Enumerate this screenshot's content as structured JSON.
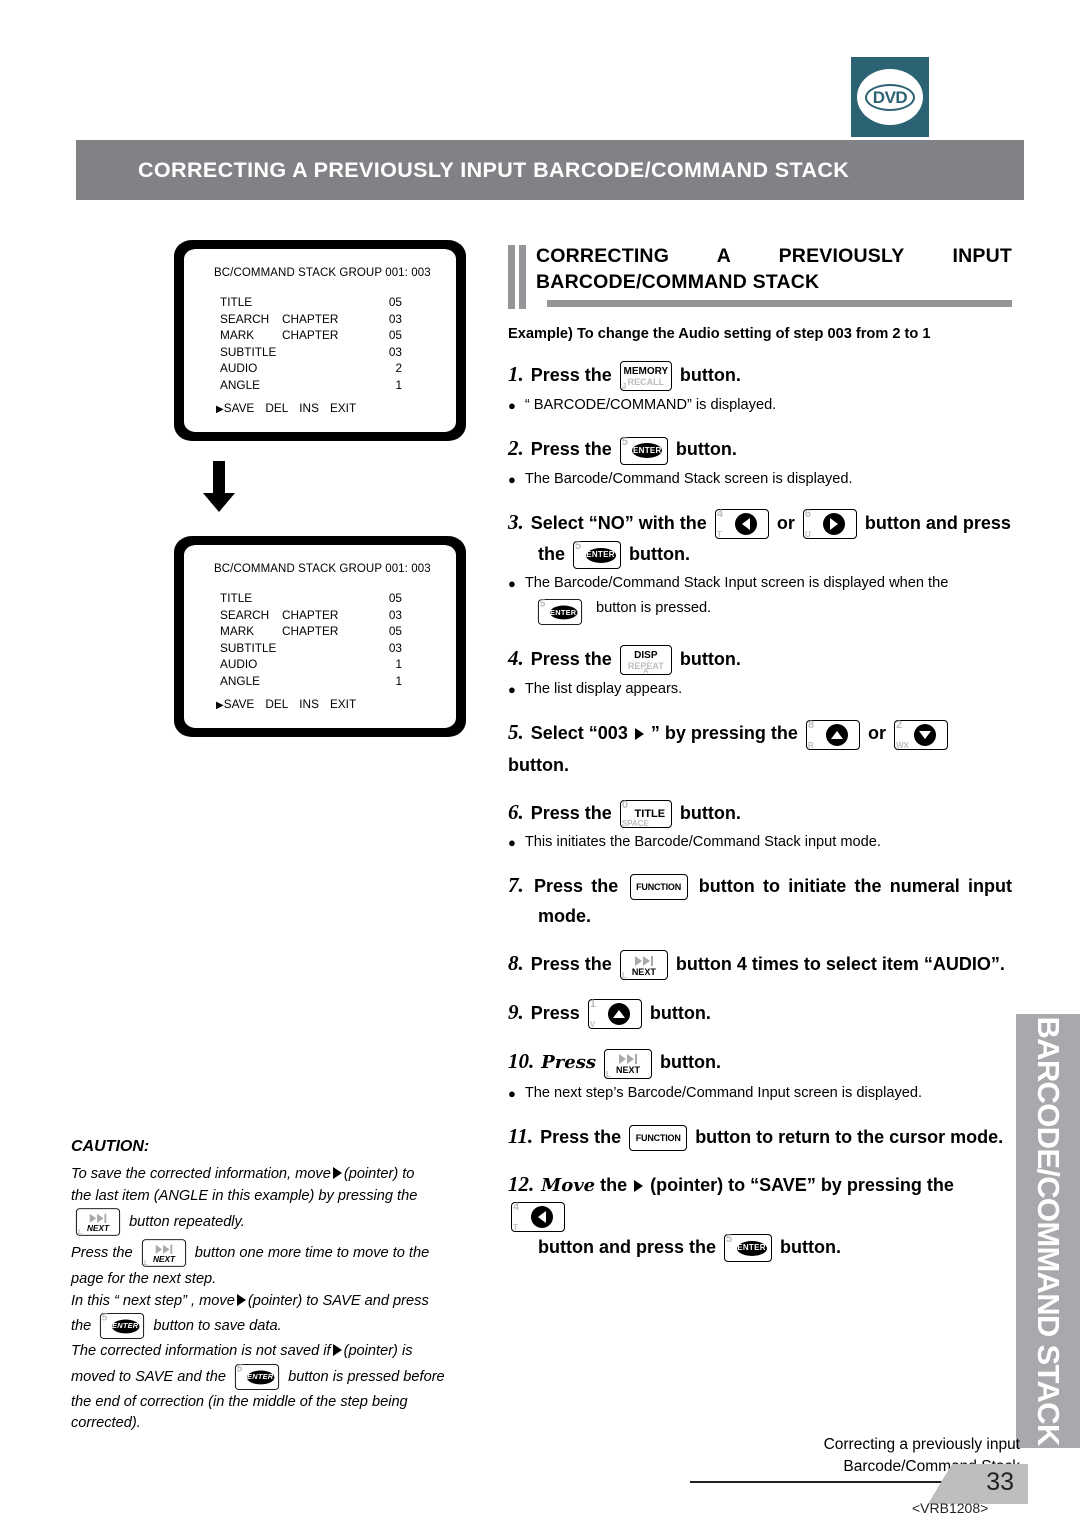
{
  "logo": {
    "text": "DVD"
  },
  "header": {
    "title": "CORRECTING A PREVIOUSLY INPUT BARCODE/COMMAND STACK"
  },
  "side_tab": {
    "text": "BARCODE/COMMAND STACK"
  },
  "section": {
    "title_line1": "CORRECTING A PREVIOUSLY INPUT",
    "title_line2": "BARCODE/COMMAND STACK",
    "example": "Example) To change the Audio setting of step 003 from 2 to 1"
  },
  "screens": [
    {
      "header": "BC/COMMAND STACK  GROUP  001: 003",
      "rows": [
        {
          "label": "TITLE",
          "label2": "",
          "value": "05"
        },
        {
          "label": "SEARCH",
          "label2": "CHAPTER",
          "value": "03"
        },
        {
          "label": "MARK",
          "label2": "CHAPTER",
          "value": "05"
        },
        {
          "label": "SUBTITLE",
          "label2": "",
          "value": "03"
        },
        {
          "label": "AUDIO",
          "label2": "",
          "value": "2"
        },
        {
          "label": "ANGLE",
          "label2": "",
          "value": "1"
        }
      ],
      "menu": [
        "SAVE",
        "DEL",
        "INS",
        "EXIT"
      ]
    },
    {
      "header": "BC/COMMAND STACK  GROUP  001: 003",
      "rows": [
        {
          "label": "TITLE",
          "label2": "",
          "value": "05"
        },
        {
          "label": "SEARCH",
          "label2": "CHAPTER",
          "value": "03"
        },
        {
          "label": "MARK",
          "label2": "CHAPTER",
          "value": "05"
        },
        {
          "label": "SUBTITLE",
          "label2": "",
          "value": "03"
        },
        {
          "label": "AUDIO",
          "label2": "",
          "value": "1"
        },
        {
          "label": "ANGLE",
          "label2": "",
          "value": "1"
        }
      ],
      "menu": [
        "SAVE",
        "DEL",
        "INS",
        "EXIT"
      ]
    }
  ],
  "buttons": {
    "memory_recall": {
      "top": "MEMORY",
      "mid": "RECALL",
      "corner": "J"
    },
    "enter": {
      "label": "ENTER",
      "corner": "5"
    },
    "left": {
      "corner_top": "4",
      "corner_bottom": "T"
    },
    "right": {
      "corner_top": "6",
      "corner_bottom": "U"
    },
    "up": {
      "corner_top": "8",
      "corner_bottom": "R"
    },
    "down": {
      "corner_top": "2",
      "corner_bottom": "WX"
    },
    "disp_repeat": {
      "top": "DISP",
      "mid": "REPEAT",
      "corner": "A"
    },
    "title": {
      "label": "TITLE",
      "corner_top": "0",
      "corner_bottom": "SPACE"
    },
    "function": {
      "label": "FUNCTION"
    },
    "next": {
      "label": "NEXT",
      "corner": "L"
    },
    "one": {
      "corner_top": "1",
      "corner_bottom": "V"
    }
  },
  "steps": [
    {
      "num": "1.",
      "text_before": "Press the",
      "button": "memory_recall",
      "text_after": "button.",
      "bullets": [
        "“ BARCODE/COMMAND”  is displayed."
      ]
    },
    {
      "num": "2.",
      "text_before": "Press the",
      "button": "enter",
      "text_after": "button.",
      "bullets": [
        "The Barcode/Command Stack screen is displayed."
      ]
    },
    {
      "num": "3.",
      "text_before": "Select “NO” with the",
      "text_mid": "or",
      "text_after": "button and press",
      "text_line2_before": "the",
      "text_line2_after": "button.",
      "bullets": [
        "The Barcode/Command Stack Input screen is displayed when the",
        "button is pressed."
      ]
    },
    {
      "num": "4.",
      "text_before": "Press the",
      "button": "disp_repeat",
      "text_after": "button.",
      "bullets": [
        "The list display appears."
      ]
    },
    {
      "num": "5.",
      "text_before": "Select “003",
      "text_mid2": "” by pressing the",
      "text_mid": "or",
      "text_after": "button.",
      "bullets": []
    },
    {
      "num": "6.",
      "text_before": "Press the",
      "button": "title",
      "text_after": "button.",
      "bullets": [
        "This initiates the Barcode/Command Stack input mode."
      ]
    },
    {
      "num": "7.",
      "text_before": "Press the",
      "button": "function",
      "text_after": "button to initiate the numeral input",
      "text_line2": "mode.",
      "bullets": []
    },
    {
      "num": "8.",
      "text_before": "Press the",
      "button": "next",
      "text_after": "button 4 times to select item “AUDIO”.",
      "bullets": []
    },
    {
      "num": "9.",
      "text_before": "Press",
      "button": "one",
      "text_after": "button.",
      "bullets": []
    },
    {
      "num": "10.",
      "script": "Press",
      "button": "next",
      "text_after": "button.",
      "bullets": [
        "The next step’s Barcode/Command Input screen is displayed."
      ]
    },
    {
      "num": "11.",
      "text_before": "Press the",
      "button": "function",
      "text_after": "button to return to the cursor mode.",
      "bullets": []
    },
    {
      "num": "12.",
      "script": "Move",
      "text_before": "the",
      "text_mid2": "(pointer) to “SAVE” by pressing the",
      "text_line2_before": "button and press the",
      "text_line2_after": "button.",
      "bullets": []
    }
  ],
  "caution": {
    "title": "CAUTION:",
    "p1a": "To save the corrected information, move",
    "p1b": "(pointer) to",
    "p2": "the last item (ANGLE in this example) by pressing the",
    "p3": "button repeatedly.",
    "p4a": "Press the",
    "p4b": "button one more time to move to the",
    "p5": "page for the next step.",
    "p6a": "In this “ next step” , move",
    "p6b": "(pointer) to SAVE and press",
    "p7a": "the",
    "p7b": "button to save data.",
    "p8a": "The corrected information is not saved if",
    "p8b": "(pointer) is",
    "p9a": "moved to SAVE and the",
    "p9b": "button is pressed before",
    "p10": "the end of correction (in the middle of the step being",
    "p11": "corrected)."
  },
  "footer": {
    "line1": "Correcting a previously input",
    "line2": "Barcode/Command Stack",
    "page": "33",
    "code": "<VRB1208>"
  },
  "colors": {
    "header_gray": "#808285",
    "tab_gray": "#a7a9ac",
    "rule_gray": "#939598",
    "dvd_teal": "#2b6274"
  }
}
